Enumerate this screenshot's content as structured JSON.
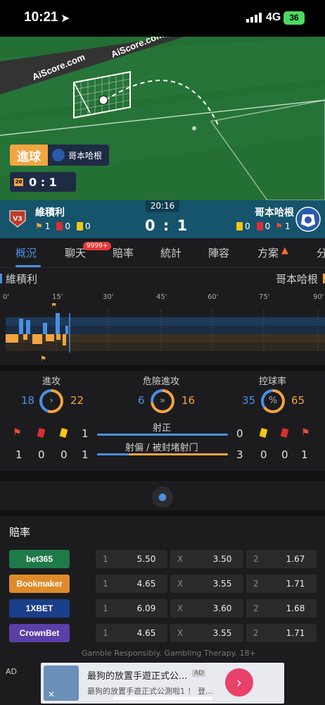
{
  "status": {
    "time": "10:21",
    "network": "4G",
    "battery": "36"
  },
  "pitch": {
    "watermark": "AiScore.com",
    "event_label": "進球",
    "event_team": "哥本哈根",
    "minute_flag": "20",
    "score": "0 : 1"
  },
  "match": {
    "clock": "20:16",
    "home": {
      "name": "維積利",
      "crest": "V3",
      "corners": "1",
      "red": "0",
      "yellow": "0"
    },
    "away": {
      "name": "哥本哈根",
      "corners": "1",
      "red": "0",
      "yellow": "0"
    },
    "score": "0 : 1"
  },
  "tabs": [
    {
      "label": "概況"
    },
    {
      "label": "聊天",
      "badge": "9999+"
    },
    {
      "label": "賠率"
    },
    {
      "label": "統計"
    },
    {
      "label": "陣容"
    },
    {
      "label": "方案"
    },
    {
      "label": "分"
    }
  ],
  "team_labels": {
    "home": "維積利",
    "away": "哥本哈根"
  },
  "timeline": {
    "ticks": [
      "0'",
      "15'",
      "30'",
      "45'",
      "60'",
      "75'",
      "90'"
    ]
  },
  "stats": {
    "attack": {
      "label": "進攻",
      "home": "18",
      "away": "22"
    },
    "danger": {
      "label": "危險進攻",
      "home": "6",
      "away": "16"
    },
    "possession": {
      "label": "控球率",
      "home": "35",
      "away": "65",
      "icon_text": "%"
    },
    "on_target": {
      "label": "射正",
      "home": "1",
      "away": "0"
    },
    "off_target": {
      "label": "射偏 / 被封堵射门",
      "home": "1",
      "away": "3"
    },
    "home_row": {
      "corners": "1",
      "red": "0",
      "yellow": "0"
    },
    "away_row": {
      "yellow": "0",
      "red": "0",
      "corners": "1"
    }
  },
  "odds": {
    "title": "賠率",
    "rows": [
      {
        "book": "bet365",
        "color": "#1f7a4a",
        "v1": "5.50",
        "vx": "3.50",
        "v2": "1.67"
      },
      {
        "book": "Bookmaker",
        "color": "#e08b2a",
        "v1": "4.65",
        "vx": "3.55",
        "v2": "1.71"
      },
      {
        "book": "1XBET",
        "color": "#1a3f8a",
        "v1": "6.09",
        "vx": "3.60",
        "v2": "1.68"
      },
      {
        "book": "CrownBet",
        "color": "#5b3fa8",
        "v1": "4.65",
        "vx": "3.55",
        "v2": "1.71"
      }
    ],
    "labels": {
      "one": "1",
      "x": "X",
      "two": "2"
    },
    "disclaimer": "Gamble Responsibly. Gambling Therapy. 18+"
  },
  "ad": {
    "tag": "AD",
    "title": "最狗的放置手遊正式公...",
    "subtitle": "最狗的放置手遊正式公測啦1 ！ 登...",
    "inner_tag": "AD"
  }
}
